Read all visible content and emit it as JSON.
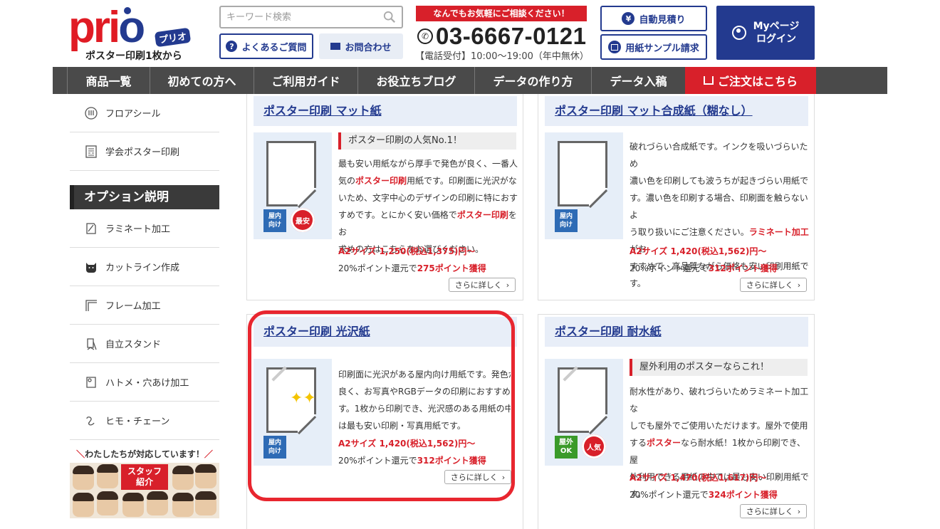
{
  "header": {
    "logo_word_a": "pri",
    "logo_word_b": "o",
    "logo_badge": "プリオ",
    "logo_tagline": "ポスター印刷1枚から",
    "search_placeholder": "キーワード検索",
    "faq_label": "よくあるご質問",
    "contact_label": "お問合わせ",
    "consult_banner": "なんでもお気軽にご相談ください！",
    "phone_number": "03-6667-0121",
    "hours": "【電話受付】10:00〜19:00（年中無休）",
    "quote_label": "自動見積り",
    "sample_label": "用紙サンプル請求",
    "mypage_line1": "Myページ",
    "mypage_line2": "ログイン"
  },
  "nav": [
    {
      "label": "商品一覧"
    },
    {
      "label": "初めての方へ"
    },
    {
      "label": "ご利用ガイド"
    },
    {
      "label": "お役立ちブログ"
    },
    {
      "label": "データの作り方"
    },
    {
      "label": "データ入稿"
    },
    {
      "label": "ご注文はこちら"
    }
  ],
  "sidebar": {
    "top_items": [
      {
        "label": "フロアシール",
        "icon": "floor-sticker-icon"
      },
      {
        "label": "学会ポスター印刷",
        "icon": "conference-poster-icon"
      }
    ],
    "options_heading": "オプション説明",
    "option_items": [
      {
        "label": "ラミネート加工",
        "icon": "laminate-icon"
      },
      {
        "label": "カットライン作成",
        "icon": "cat-cutline-icon"
      },
      {
        "label": "フレーム加工",
        "icon": "frame-icon"
      },
      {
        "label": "自立スタンド",
        "icon": "stand-icon"
      },
      {
        "label": "ハトメ・穴あけ加工",
        "icon": "grommet-icon"
      },
      {
        "label": "ヒモ・チェーン",
        "icon": "string-chain-icon"
      }
    ],
    "staff_caption": "わたしたちが対応しています！",
    "staff_label_line1": "スタッフ",
    "staff_label_line2": "紹介"
  },
  "products": [
    {
      "title": "ポスター印刷 マット紙",
      "catch": "ポスター印刷の人気No.1！",
      "desc_1": "最も安い用紙ながら厚手で発色が良く、一番人",
      "desc_2a": "気の",
      "desc_2hl": "ポスター印刷",
      "desc_2b": "用紙です。印刷面に光沢がな",
      "desc_3": "いため、文字中心のデザインの印刷に特におす",
      "desc_4a": "すめです。とにかく安い価格で",
      "desc_4hl": "ポスター印刷",
      "desc_4b": "をお",
      "desc_5": "求めの方はこちらをお選びください。",
      "price": "A2サイズ 1,250(税込1,375)円〜",
      "points_text": "20%ポイント還元で",
      "points_hl": "275ポイント獲得",
      "tag_line1": "屋内",
      "tag_line2": "向け",
      "seal": "最安",
      "more": "さらに詳しく"
    },
    {
      "title": "ポスター印刷 マット合成紙（糊なし）",
      "desc_1": "破れづらい合成紙です。インクを吸いづらいため",
      "desc_2": "濃い色を印刷しても波うちが起きづらい用紙で",
      "desc_3": "す。濃い色を印刷する場合、印刷面を触らないよ",
      "desc_4a": "う取り扱いにご注意ください。",
      "desc_4hl": "ラミネート加工",
      "desc_4b": "がお",
      "desc_5": "すすめで、高品質ながら価格も安い印刷用紙で",
      "desc_6": "す。",
      "price": "A2サイズ 1,420(税込1,562)円〜",
      "points_text": "20%ポイント還元で",
      "points_hl": "312ポイント獲得",
      "tag_line1": "屋内",
      "tag_line2": "向け",
      "more": "さらに詳しく"
    },
    {
      "title": "ポスター印刷 光沢紙",
      "desc_1": "印刷面に光沢がある屋内向け用紙です。発色が",
      "desc_2": "良く、お写真やRGBデータの印刷におすすめで",
      "desc_3": "す。1枚から印刷でき、光沢感のある用紙の中で",
      "desc_4": "は最も安い印刷・写真用紙です。",
      "price": "A2サイズ 1,420(税込1,562)円〜",
      "points_text": "20%ポイント還元で",
      "points_hl": "312ポイント獲得",
      "tag_line1": "屋内",
      "tag_line2": "向け",
      "more": "さらに詳しく"
    },
    {
      "title": "ポスター印刷 耐水紙",
      "catch": "屋外利用のポスターならこれ！",
      "desc_1": "耐水性があり、破れづらいためラミネート加工な",
      "desc_2": "しでも屋外でご使用いただけます。屋外で使用",
      "desc_3a": "する",
      "desc_3hl": "ポスター",
      "desc_3b": "なら耐水紙！1枚から印刷でき、屋",
      "desc_4": "外利用できる用紙の中では最も安い印刷用紙で",
      "desc_5": "す。",
      "price": "A2サイズ 1,470(税込1,617)円〜",
      "points_text": "20%ポイント還元で",
      "points_hl": "324ポイント獲得",
      "tag_line1": "屋外",
      "tag_line2": "OK",
      "seal": "人気",
      "more": "さらに詳しく"
    }
  ],
  "colors": {
    "brand_navy": "#233a8f",
    "brand_red": "#d8202a",
    "nav_gray": "#4a4a4a",
    "highlight_ring": "#e8262f"
  }
}
